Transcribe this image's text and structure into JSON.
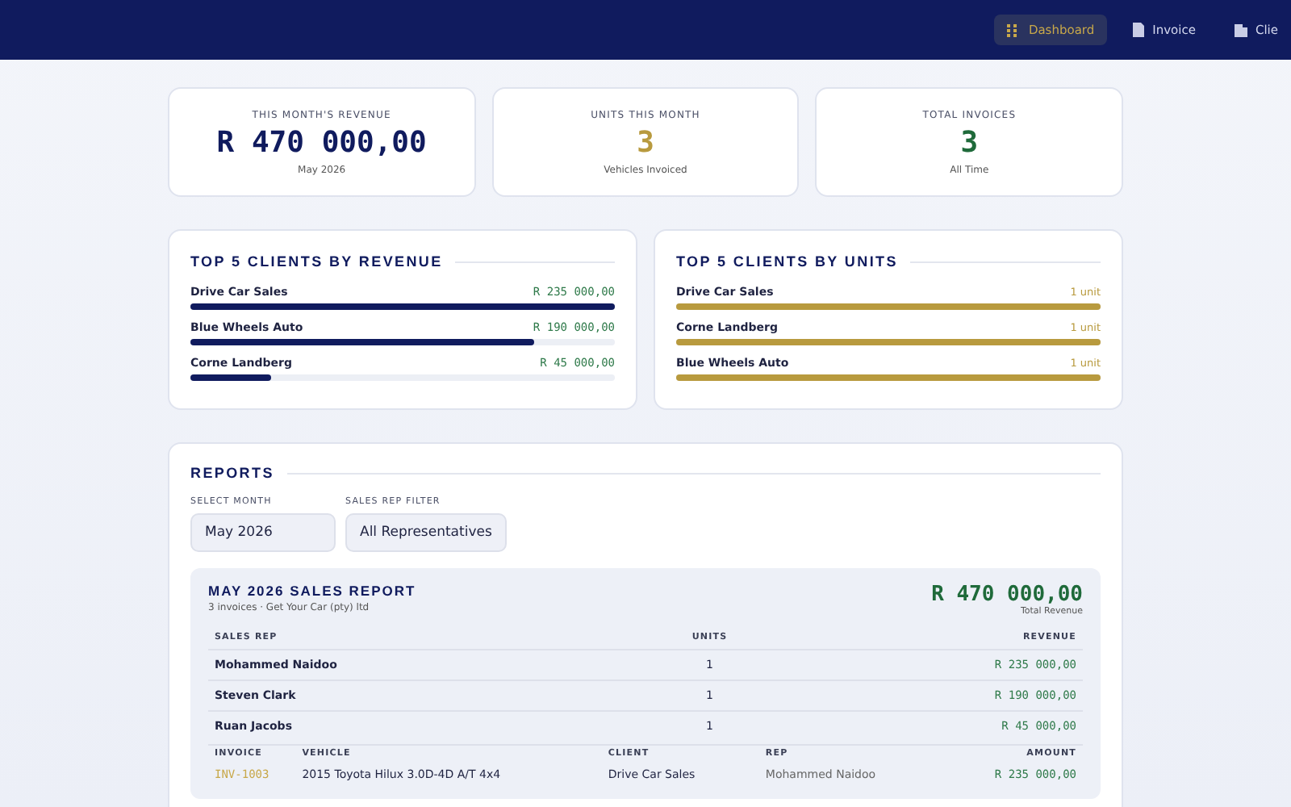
{
  "nav": [
    {
      "label": "Dashboard",
      "selected": true
    },
    {
      "label": "Invoice",
      "selected": false
    },
    {
      "label": "Clie",
      "selected": false
    }
  ],
  "stats": [
    {
      "label": "THIS MONTH'S REVENUE",
      "value": "R 470 000,00",
      "sub": "May 2026",
      "kind": "money"
    },
    {
      "label": "UNITS THIS MONTH",
      "value": "3",
      "sub": "Vehicles Invoiced",
      "kind": "units"
    },
    {
      "label": "TOTAL INVOICES",
      "value": "3",
      "sub": "All Time",
      "kind": "count"
    }
  ],
  "top_clients": [
    {
      "title": "TOP 5 CLIENTS BY REVENUE",
      "kind": "revenue",
      "items": [
        {
          "name": "Drive Car Sales",
          "value": "R 235 000,00",
          "level": 1
        },
        {
          "name": "Blue Wheels Auto",
          "value": "R 190 000,00",
          "level": 0.81
        },
        {
          "name": "Corne Landberg",
          "value": "R 45 000,00",
          "level": 0.19
        }
      ]
    },
    {
      "title": "TOP 5 CLIENTS BY UNITS",
      "kind": "units",
      "items": [
        {
          "name": "Drive Car Sales",
          "value": "1 unit",
          "level": 1
        },
        {
          "name": "Corne Landberg",
          "value": "1 unit",
          "level": 1
        },
        {
          "name": "Blue Wheels Auto",
          "value": "1 unit",
          "level": 1
        }
      ]
    }
  ],
  "reports": {
    "title": "REPORTS",
    "filters": [
      {
        "label": "SELECT MONTH",
        "value": "May 2026"
      },
      {
        "label": "SALES REP FILTER",
        "value": "All Representatives"
      }
    ],
    "report": {
      "title": "MAY 2026 SALES REPORT",
      "subtitle": "3 invoices · Get Your Car (pty) ltd",
      "total": "R 470 000,00",
      "total_label": "Total Revenue",
      "rep_columns": [
        "SALES REP",
        "UNITS",
        "REVENUE"
      ],
      "rep_rows": [
        [
          "Mohammed Naidoo",
          "1",
          "R 235 000,00"
        ],
        [
          "Steven Clark",
          "1",
          "R 190 000,00"
        ],
        [
          "Ruan Jacobs",
          "1",
          "R 45 000,00"
        ]
      ],
      "invoice_columns": [
        "INVOICE",
        "VEHICLE",
        "CLIENT",
        "REP",
        "AMOUNT"
      ],
      "invoice_rows": [
        [
          "INV-1003",
          "2015 Toyota Hilux 3.0D-4D A/T 4x4",
          "Drive Car Sales",
          "Mohammed Naidoo",
          "R 235 000,00"
        ]
      ]
    }
  }
}
